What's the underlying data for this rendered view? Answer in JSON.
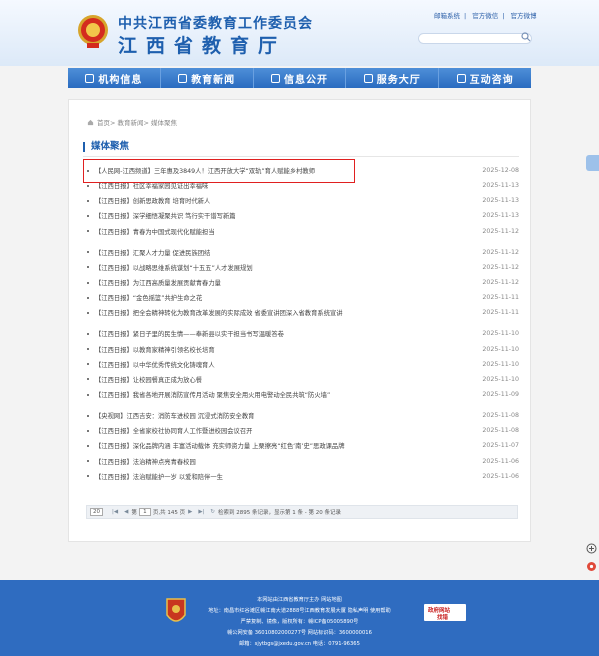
{
  "header": {
    "title_cn": "中共江西省委教育工作委员会",
    "title_main": "江西省教育厅",
    "top_links": [
      "邮箱系统",
      "官方微信",
      "官方微博"
    ]
  },
  "nav": [
    {
      "label": "机构信息",
      "icon": "building-icon"
    },
    {
      "label": "教育新闻",
      "icon": "newspaper-icon"
    },
    {
      "label": "信息公开",
      "icon": "document-icon"
    },
    {
      "label": "服务大厅",
      "icon": "hall-icon"
    },
    {
      "label": "互动咨询",
      "icon": "chat-icon"
    }
  ],
  "breadcrumb": "首页> 教育新闻> 媒体聚焦",
  "section_title": "媒体聚焦",
  "news": [
    {
      "title": "【人民网-江西频道】三年惠及3849人！江西开放大学“双轨”育人赋能乡村教师",
      "date": "2025-12-08"
    },
    {
      "title": "【江西日报】社区幸福家园见证出幸福味",
      "date": "2025-11-13"
    },
    {
      "title": "【江西日报】创新思政教育 培育时代新人",
      "date": "2025-11-13"
    },
    {
      "title": "【江西日报】深学细悟凝聚共识 笃行实干谱写新篇",
      "date": "2025-11-13"
    },
    {
      "title": "【江西日报】青春为中国式现代化赋能担当",
      "date": "2025-11-12"
    },
    {
      "title": "【江西日报】汇聚人才力量 促进民族团结",
      "date": "2025-11-12"
    },
    {
      "title": "【江西日报】以战略思维系统谋划“十五五”人才发展规划",
      "date": "2025-11-12"
    },
    {
      "title": "【江西日报】为江西高质量发展贡献青春力量",
      "date": "2025-11-12"
    },
    {
      "title": "【江西日报】“金色摇篮”共护生命之花",
      "date": "2025-11-11"
    },
    {
      "title": "【江西日报】把全会精神转化为教育改革发展的实际成效 省委宣讲团深入省教育系统宣讲",
      "date": "2025-11-11"
    },
    {
      "title": "【江西日报】紧日子里的民生情——奉新县以实干担当书写温暖答卷",
      "date": "2025-11-10"
    },
    {
      "title": "【江西日报】以教育家精神引领名校长培育",
      "date": "2025-11-10"
    },
    {
      "title": "【江西日报】以中华优秀传统文化铸魂育人",
      "date": "2025-11-10"
    },
    {
      "title": "【江西日报】让校园餐真正成为放心餐",
      "date": "2025-11-10"
    },
    {
      "title": "【江西日报】我省各地开展消防宣传月活动 聚焦安全用火用电警动全民共筑“防火墙”",
      "date": "2025-11-09"
    },
    {
      "title": "【央视网】江西吉安：消防车进校园 沉浸式消防安全教育",
      "date": "2025-11-08"
    },
    {
      "title": "【江西日报】全省家校社协同育人工作暨进校园会议召开",
      "date": "2025-11-08"
    },
    {
      "title": "【江西日报】深化品牌内涵 丰富活动载体 充实师资力量 上栗擦亮“红色‘南’史”思政课品牌",
      "date": "2025-11-07"
    },
    {
      "title": "【江西日报】法治精神点亮青春校园",
      "date": "2025-11-06"
    },
    {
      "title": "【江西日报】法治赋能护一岁 以爱和陪伴一生",
      "date": "2025-11-06"
    }
  ],
  "pager": {
    "page_size": "20",
    "page_prefix": "第",
    "current_page": "1",
    "page_suffix": "页,共 145 页",
    "summary": "检索到 2895 条记录，显示第 1 条 - 第 20 条记录"
  },
  "footer": {
    "line1": "本网站由江西省教育厅主办 网站地图",
    "line2": "地址：南昌市红谷滩区赣江南大道2888号江西教育发展大厦 隐私声明 使用帮助",
    "line3": "严禁复制、镜像，版权所有：赣ICP备05005890号",
    "line4": "赣公网安备 36010802000277号 网站标识码：3600000016",
    "line5": "邮箱：sjytbgs@jxedu.gov.cn 电话：0791-96365",
    "badge_top": "政府网站",
    "badge_bottom": "找错"
  },
  "colors": {
    "brand_blue": "#1e5fae",
    "nav_blue": "#2a6bc0",
    "footer_blue": "#2f6cc0",
    "highlight_red": "#e02020"
  }
}
